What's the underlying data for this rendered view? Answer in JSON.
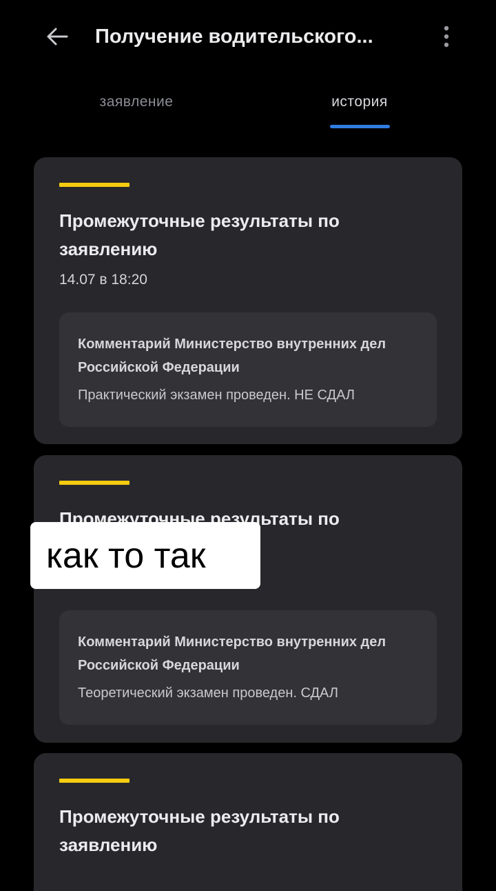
{
  "header": {
    "title": "Получение водительского..."
  },
  "tabs": [
    {
      "label": "заявление",
      "active": false
    },
    {
      "label": "история",
      "active": true
    }
  ],
  "colors": {
    "accent_bar": "#f6cc10",
    "active_tab_indicator": "#2f7de1",
    "card_background": "#28282c",
    "background": "#000000"
  },
  "history": [
    {
      "title": "Промежуточные результаты по заявлению",
      "date": "14.07 в 18:20",
      "comment_heading": "Комментарий Министерство внутренних дел Российской Федерации",
      "comment_text": "Практический экзамен проведен. НЕ СДАЛ"
    },
    {
      "title": "Промежуточные результаты по",
      "comment_heading": "Комментарий Министерство внутренних дел Российской Федерации",
      "comment_text": "Теоретический экзамен проведен. СДАЛ"
    },
    {
      "title": "Промежуточные результаты по заявлению"
    }
  ],
  "overlay_caption": "как то так",
  "icons": {
    "back": "arrow-left-icon",
    "more": "more-vertical-icon"
  }
}
